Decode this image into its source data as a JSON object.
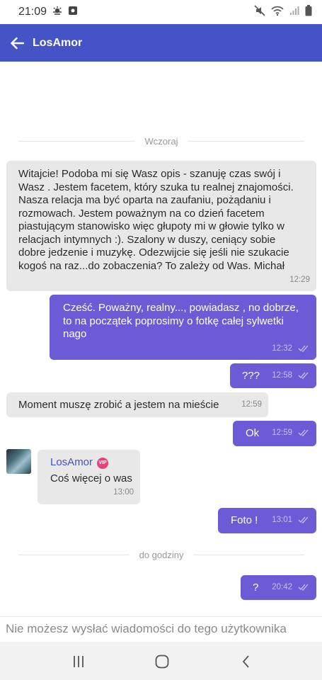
{
  "status_bar": {
    "time": "21:09",
    "icons": [
      "weather-icon",
      "notification-icon",
      "mute-icon",
      "wifi-icon",
      "signal-icon",
      "battery-icon"
    ]
  },
  "header": {
    "title": "LosAmor",
    "color": "#4453c5"
  },
  "separators": {
    "yesterday": "Wczoraj",
    "hours": "do godziny"
  },
  "messages": [
    {
      "direction": "in",
      "lines": [
        "Witajcie! Podoba mi się Wasz opis - szanuję czas swój i",
        "Wasz . Jestem facetem, który szuka tu realnej znajomości.",
        "Nasza relacja ma być oparta na zaufaniu, pożądaniu i",
        "rozmowach. Jestem poważnym na co dzień facetem",
        "piastującym stanowisko więc głupoty mi w głowie tylko w",
        "relacjach intymnych :). Szalony w duszy, ceniący sobie",
        "dobre jedzenie i muzykę. Odezwijcie się jeśli nie szukacie",
        "kogoś na raz...do zobaczenia? To zależy od Was. Michał"
      ],
      "time": "12:29"
    },
    {
      "direction": "out",
      "lines": [
        "Cześć. Poważny, realny..., powiadasz , no dobrze,",
        "to na początek poprosimy o fotkę całej sylwetki",
        "nago"
      ],
      "time": "12:32"
    },
    {
      "direction": "out",
      "text": "???",
      "time": "12:58"
    },
    {
      "direction": "in",
      "text": "Moment muszę zrobić a jestem na mieście",
      "time": "12:59"
    },
    {
      "direction": "out",
      "text": "Ok",
      "time": "12:59"
    },
    {
      "direction": "in",
      "sender": "LosAmor",
      "badge": "VIP",
      "text": "Coś więcej o was",
      "time": "13:00"
    },
    {
      "direction": "out",
      "text": "Foto !",
      "time": "13:01"
    },
    {
      "direction": "out",
      "text": "?",
      "time": "20:42"
    }
  ],
  "footer": {
    "note": "Nie możesz wysłać wiadomości do tego użytkownika"
  },
  "colors": {
    "outgoing": "#6b5bd6",
    "incoming": "#e8e8e8",
    "vip_badge": "#e8417d"
  }
}
